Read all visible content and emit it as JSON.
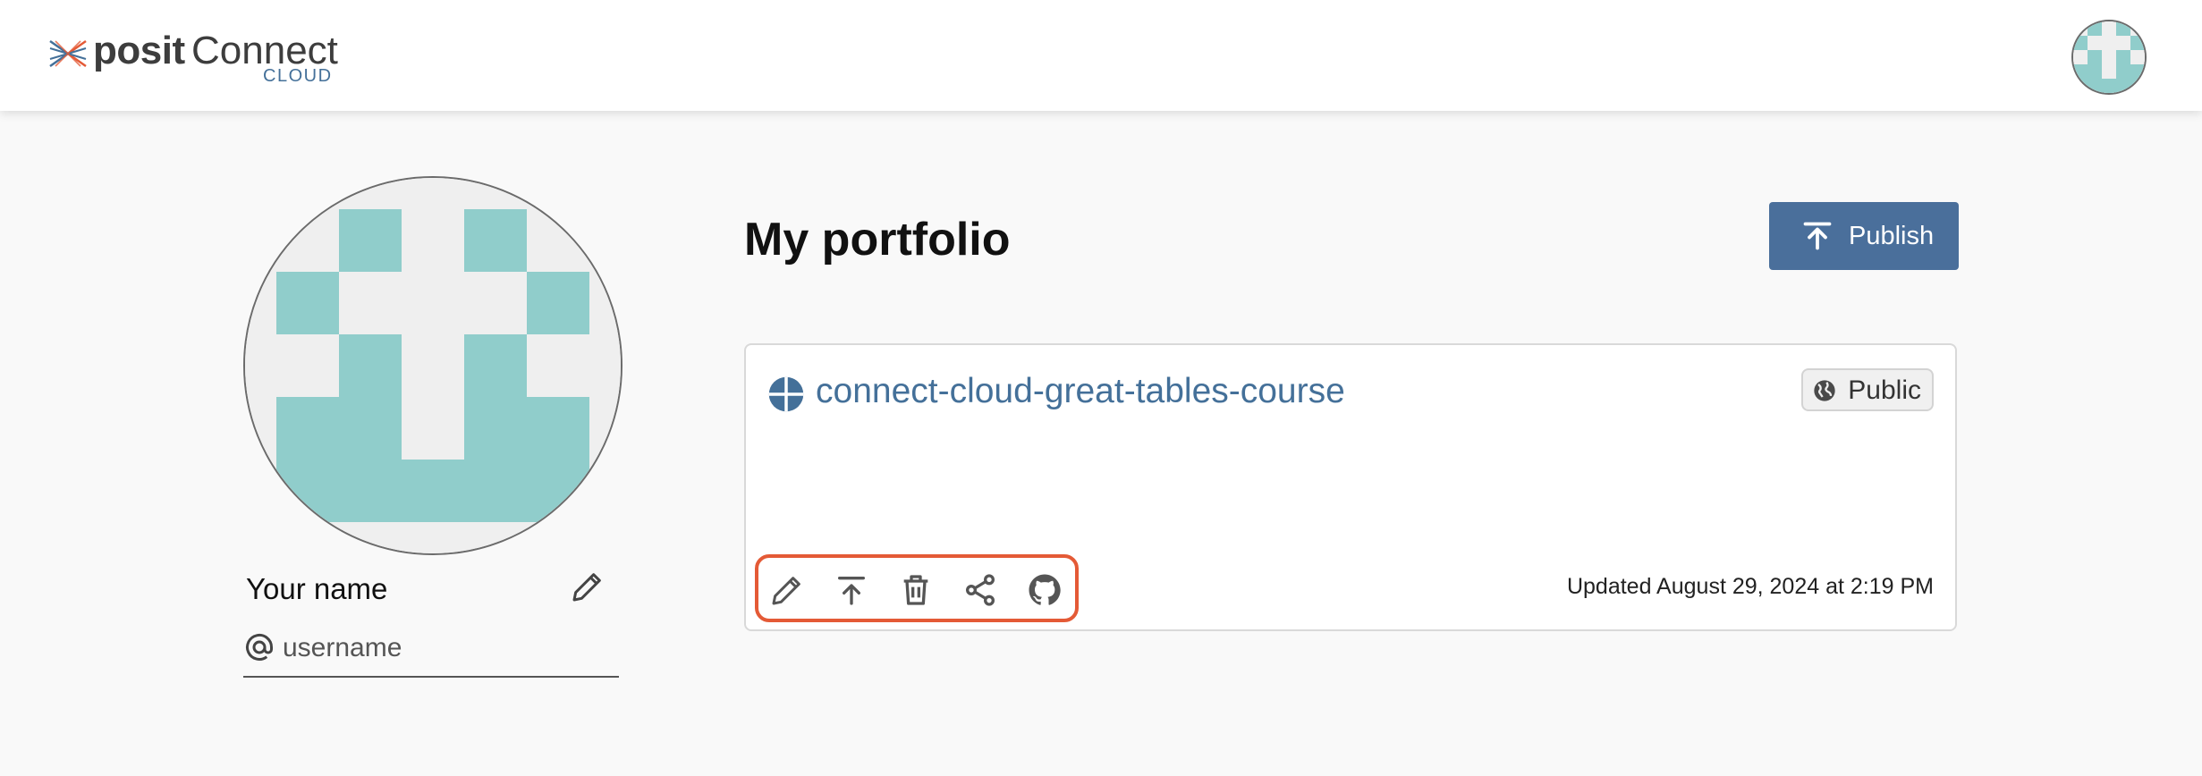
{
  "header": {
    "logo": {
      "brand": "posit",
      "product": "Connect",
      "sub": "CLOUD"
    },
    "avatar_icon": "identicon-avatar"
  },
  "profile": {
    "name": "Your name",
    "username_placeholder": "username",
    "name_edit_icon": "pencil-icon",
    "username_icon": "at-icon"
  },
  "main": {
    "title": "My portfolio",
    "publish_label": "Publish"
  },
  "content_card": {
    "title": "connect-cloud-great-tables-course",
    "visibility": "Public",
    "updated": "Updated August 29, 2024 at 2:19 PM",
    "actions": [
      "edit",
      "republish",
      "delete",
      "share",
      "github"
    ]
  },
  "colors": {
    "accent": "#4a6f9b",
    "link": "#447099",
    "avatar_teal": "#90cdcb",
    "avatar_bg": "#efefef",
    "highlight": "#e45a36"
  }
}
